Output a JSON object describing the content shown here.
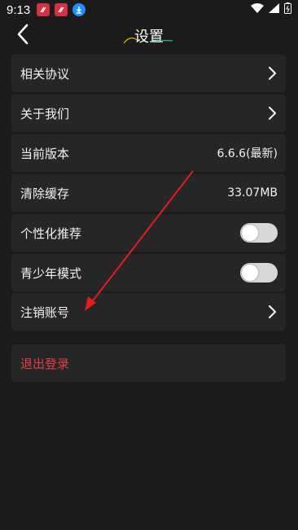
{
  "status_bar": {
    "time": "9:13"
  },
  "header": {
    "title": "设置"
  },
  "settings": {
    "items": [
      {
        "label": "相关协议"
      },
      {
        "label": "关于我们"
      },
      {
        "label": "当前版本",
        "value": "6.6.6(最新)"
      },
      {
        "label": "清除缓存",
        "value": "33.07MB"
      },
      {
        "label": "个性化推荐",
        "toggle_on": false
      },
      {
        "label": "青少年模式",
        "toggle_on": false
      },
      {
        "label": "注销账号"
      }
    ],
    "logout_label": "退出登录"
  },
  "colors": {
    "background": "#1b1b1b",
    "card": "#262626",
    "logout_text": "#e04040",
    "annotation_arrow": "#e01e1e"
  }
}
